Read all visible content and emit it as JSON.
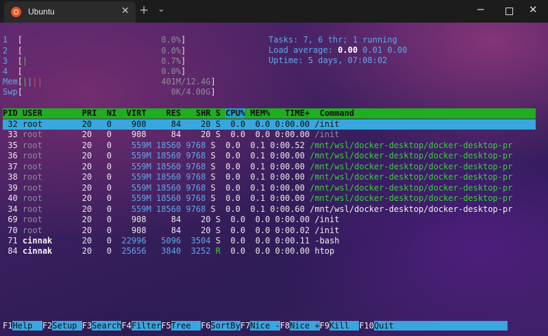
{
  "window": {
    "tab_title": "Ubuntu",
    "close_tab_icon": "close-icon",
    "new_tab_icon": "plus-icon",
    "dropdown_icon": "chevron-down-icon",
    "minimize_icon": "minimize-icon",
    "maximize_icon": "maximize-icon",
    "close_icon": "close-icon"
  },
  "meters": {
    "cpus": [
      {
        "num": "1",
        "bar": "",
        "value": "0.0%"
      },
      {
        "num": "2",
        "bar": "",
        "value": "0.0%"
      },
      {
        "num": "3",
        "bar": "|",
        "value": "0.7%"
      },
      {
        "num": "4",
        "bar": "",
        "value": "0.0%"
      }
    ],
    "mem": {
      "label": "Mem",
      "bar": "||||",
      "value": "401M/12.4G"
    },
    "swp": {
      "label": "Swp",
      "bar": "",
      "value": "0K/4.00G"
    }
  },
  "summary": {
    "tasks_label": "Tasks: ",
    "tasks_value": "7, 6 thr; 1 running",
    "load_label": "Load average: ",
    "load_1": "0.00",
    "load_5": "0.01",
    "load_15": "0.00",
    "uptime_label": "Uptime: ",
    "uptime_value": "5 days, 07:08:02"
  },
  "table": {
    "columns": [
      "PID",
      "USER",
      "PRI",
      "NI",
      "VIRT",
      "RES",
      "SHR",
      "S",
      "CPU%",
      "MEM%",
      "TIME+",
      "Command"
    ],
    "rows": [
      {
        "pid": "32",
        "user": "root",
        "pri": "20",
        "ni": "0",
        "virt": "908",
        "res": "84",
        "shr": "20",
        "s": "S",
        "cpu": "0.0",
        "mem": "0.0",
        "time": "0:00.00",
        "cmd": "/init",
        "selected": true
      },
      {
        "pid": "33",
        "user": "root",
        "pri": "20",
        "ni": "0",
        "virt": "908",
        "res": "84",
        "shr": "20",
        "s": "S",
        "cpu": "0.0",
        "mem": "0.0",
        "time": "0:00.00",
        "cmd": "/init"
      },
      {
        "pid": "35",
        "user": "root",
        "pri": "20",
        "ni": "0",
        "virt": "559M",
        "res": "18560",
        "shr": "9768",
        "s": "S",
        "cpu": "0.0",
        "mem": "0.1",
        "time": "0:00.52",
        "cmd": "/mnt/wsl/docker-desktop/docker-desktop-pr"
      },
      {
        "pid": "36",
        "user": "root",
        "pri": "20",
        "ni": "0",
        "virt": "559M",
        "res": "18560",
        "shr": "9768",
        "s": "S",
        "cpu": "0.0",
        "mem": "0.1",
        "time": "0:00.00",
        "cmd": "/mnt/wsl/docker-desktop/docker-desktop-pr"
      },
      {
        "pid": "37",
        "user": "root",
        "pri": "20",
        "ni": "0",
        "virt": "559M",
        "res": "18560",
        "shr": "9768",
        "s": "S",
        "cpu": "0.0",
        "mem": "0.1",
        "time": "0:00.00",
        "cmd": "/mnt/wsl/docker-desktop/docker-desktop-pr"
      },
      {
        "pid": "38",
        "user": "root",
        "pri": "20",
        "ni": "0",
        "virt": "559M",
        "res": "18560",
        "shr": "9768",
        "s": "S",
        "cpu": "0.0",
        "mem": "0.1",
        "time": "0:00.00",
        "cmd": "/mnt/wsl/docker-desktop/docker-desktop-pr"
      },
      {
        "pid": "39",
        "user": "root",
        "pri": "20",
        "ni": "0",
        "virt": "559M",
        "res": "18560",
        "shr": "9768",
        "s": "S",
        "cpu": "0.0",
        "mem": "0.1",
        "time": "0:00.00",
        "cmd": "/mnt/wsl/docker-desktop/docker-desktop-pr"
      },
      {
        "pid": "40",
        "user": "root",
        "pri": "20",
        "ni": "0",
        "virt": "559M",
        "res": "18560",
        "shr": "9768",
        "s": "S",
        "cpu": "0.0",
        "mem": "0.1",
        "time": "0:00.00",
        "cmd": "/mnt/wsl/docker-desktop/docker-desktop-pr"
      },
      {
        "pid": "34",
        "user": "root",
        "pri": "20",
        "ni": "0",
        "virt": "559M",
        "res": "18560",
        "shr": "9768",
        "s": "S",
        "cpu": "0.0",
        "mem": "0.1",
        "time": "0:00.60",
        "cmd": "/mnt/wsl/docker-desktop/docker-desktop-pr"
      },
      {
        "pid": "69",
        "user": "root",
        "pri": "20",
        "ni": "0",
        "virt": "908",
        "res": "84",
        "shr": "20",
        "s": "S",
        "cpu": "0.0",
        "mem": "0.0",
        "time": "0:00.00",
        "cmd": "/init"
      },
      {
        "pid": "70",
        "user": "root",
        "pri": "20",
        "ni": "0",
        "virt": "908",
        "res": "84",
        "shr": "20",
        "s": "S",
        "cpu": "0.0",
        "mem": "0.0",
        "time": "0:00.02",
        "cmd": "/init"
      },
      {
        "pid": "71",
        "user": "cinnak",
        "pri": "20",
        "ni": "0",
        "virt": "22996",
        "res": "5096",
        "shr": "3504",
        "s": "S",
        "cpu": "0.0",
        "mem": "0.0",
        "time": "0:00.11",
        "cmd": "-bash"
      },
      {
        "pid": "84",
        "user": "cinnak",
        "pri": "20",
        "ni": "0",
        "virt": "25656",
        "res": "3840",
        "shr": "3252",
        "s": "R",
        "cpu": "0.0",
        "mem": "0.0",
        "time": "0:00.00",
        "cmd": "htop"
      }
    ]
  },
  "footer": [
    {
      "key": "F1",
      "label": "Help  "
    },
    {
      "key": "F2",
      "label": "Setup "
    },
    {
      "key": "F3",
      "label": "Search"
    },
    {
      "key": "F4",
      "label": "Filter"
    },
    {
      "key": "F5",
      "label": "Tree  "
    },
    {
      "key": "F6",
      "label": "SortBy"
    },
    {
      "key": "F7",
      "label": "Nice -"
    },
    {
      "key": "F8",
      "label": "Nice +"
    },
    {
      "key": "F9",
      "label": "Kill  "
    },
    {
      "key": "F10",
      "label": "Quit  "
    }
  ],
  "colors": {
    "accent_cyan": "#5fa8e8",
    "header_green": "#1fae1f",
    "selection_blue": "#3aa6e0"
  }
}
